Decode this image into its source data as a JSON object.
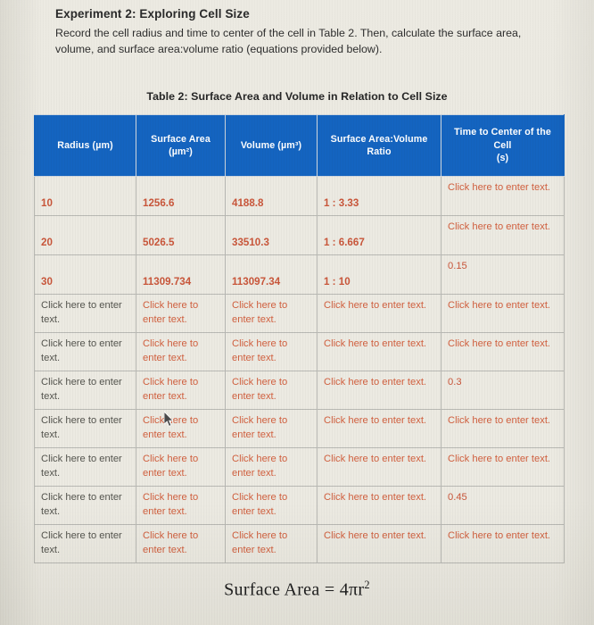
{
  "document": {
    "experiment_title": "Experiment 2: Exploring Cell Size",
    "instructions": "Record the cell radius and time to center of the cell in Table 2. Then, calculate the surface area, volume, and surface area:volume ratio (equations provided below).",
    "table_caption": "Table 2: Surface Area and Volume in Relation to Cell Size",
    "formula_label": "Surface Area = 4πr",
    "formula_exponent": "2"
  },
  "colors": {
    "header_blue": "#1464c0",
    "placeholder_red": "#d1603f",
    "placeholder_gray": "#55554f",
    "page_background": "#eceae2",
    "grid_line": "#b9b9b4"
  },
  "table": {
    "columns": [
      {
        "id": "radius",
        "label_line1": "Radius (µm)",
        "label_line2": ""
      },
      {
        "id": "surface_area",
        "label_line1": "Surface Area",
        "label_line2": "(µm²)"
      },
      {
        "id": "volume",
        "label_line1": "Volume (µm³)",
        "label_line2": ""
      },
      {
        "id": "sa_v_ratio",
        "label_line1": "Surface Area:Volume",
        "label_line2": "Ratio"
      },
      {
        "id": "time_to_center",
        "label_line1": "Time to Center of the Cell",
        "label_line2": "(s)"
      }
    ],
    "placeholder_text": "Click here to enter text.",
    "rows": [
      {
        "type": "value",
        "radius": "10",
        "surface_area": "1256.6",
        "volume": "4188.8",
        "sa_v_ratio": "1 : 3.33",
        "time_to_center": "Click here to enter text."
      },
      {
        "type": "value",
        "radius": "20",
        "surface_area": "5026.5",
        "volume": "33510.3",
        "sa_v_ratio": "1 : 6.667",
        "time_to_center": "Click here to enter text."
      },
      {
        "type": "value",
        "radius": "30",
        "surface_area": "11309.734",
        "volume": "113097.34",
        "sa_v_ratio": "1 : 10",
        "time_to_center": "0.15"
      },
      {
        "type": "placeholder",
        "radius": "Click here to enter text.",
        "surface_area": "Click here to enter text.",
        "volume": "Click here to enter text.",
        "sa_v_ratio": "Click here to enter text.",
        "time_to_center": "Click here to enter text."
      },
      {
        "type": "placeholder",
        "radius": "Click here to enter text.",
        "surface_area": "Click here to enter text.",
        "volume": "Click here to enter text.",
        "sa_v_ratio": "Click here to enter text.",
        "time_to_center": "Click here to enter text."
      },
      {
        "type": "placeholder",
        "radius": "Click here to enter text.",
        "surface_area": "Click here to enter text.",
        "volume": "Click here to enter text.",
        "sa_v_ratio": "Click here to enter text.",
        "time_to_center": "0.3"
      },
      {
        "type": "placeholder",
        "radius": "Click here to enter text.",
        "surface_area": "Click here to enter text.",
        "volume": "Click here to enter text.",
        "sa_v_ratio": "Click here to enter text.",
        "time_to_center": "Click here to enter text."
      },
      {
        "type": "placeholder",
        "radius": "Click here to enter text.",
        "surface_area": "Click here to enter text.",
        "volume": "Click here to enter text.",
        "sa_v_ratio": "Click here to enter text.",
        "time_to_center": "Click here to enter text."
      },
      {
        "type": "placeholder",
        "radius": "Click here to enter text.",
        "surface_area": "Click here to enter text.",
        "volume": "Click here to enter text.",
        "sa_v_ratio": "Click here to enter text.",
        "time_to_center": "0.45"
      },
      {
        "type": "placeholder",
        "radius": "Click here to enter text.",
        "surface_area": "Click here to enter text.",
        "volume": "Click here to enter text.",
        "sa_v_ratio": "Click here to enter text.",
        "time_to_center": "Click here to enter text."
      }
    ]
  }
}
